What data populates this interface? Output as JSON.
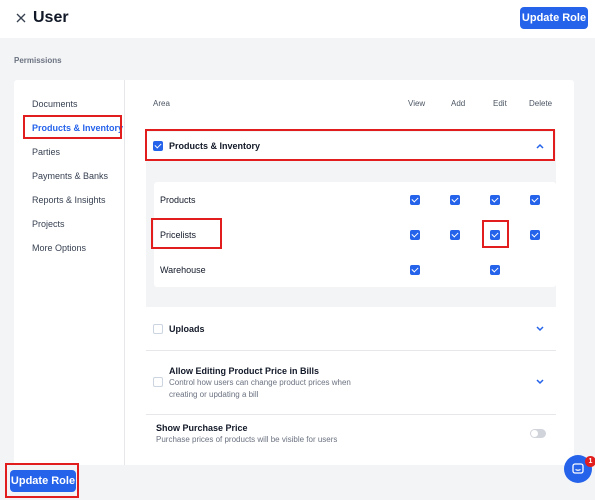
{
  "header": {
    "title": "User",
    "update_button": "Update Role"
  },
  "section_label": "Permissions",
  "sidebar": {
    "items": [
      {
        "label": "Documents"
      },
      {
        "label": "Products & Inventory"
      },
      {
        "label": "Parties"
      },
      {
        "label": "Payments & Banks"
      },
      {
        "label": "Reports & Insights"
      },
      {
        "label": "Projects"
      },
      {
        "label": "More Options"
      }
    ]
  },
  "table": {
    "columns": [
      "Area",
      "View",
      "Add",
      "Edit",
      "Delete"
    ],
    "group": {
      "label": "Products & Inventory"
    },
    "rows": [
      {
        "label": "Products"
      },
      {
        "label": "Pricelists"
      },
      {
        "label": "Warehouse"
      }
    ]
  },
  "uploads": {
    "label": "Uploads"
  },
  "allow_editing": {
    "label": "Allow Editing Product Price in Bills",
    "desc_line1": "Control how users can change product prices when",
    "desc_line2": "creating or updating a bill"
  },
  "purchase_price": {
    "label": "Show Purchase Price",
    "desc": "Purchase prices of products will be visible for users"
  },
  "footer": {
    "update_button": "Update Role"
  },
  "chat": {
    "badge_count": "1"
  },
  "colors": {
    "accent": "#2563eb",
    "highlight": "#e11d1d"
  }
}
